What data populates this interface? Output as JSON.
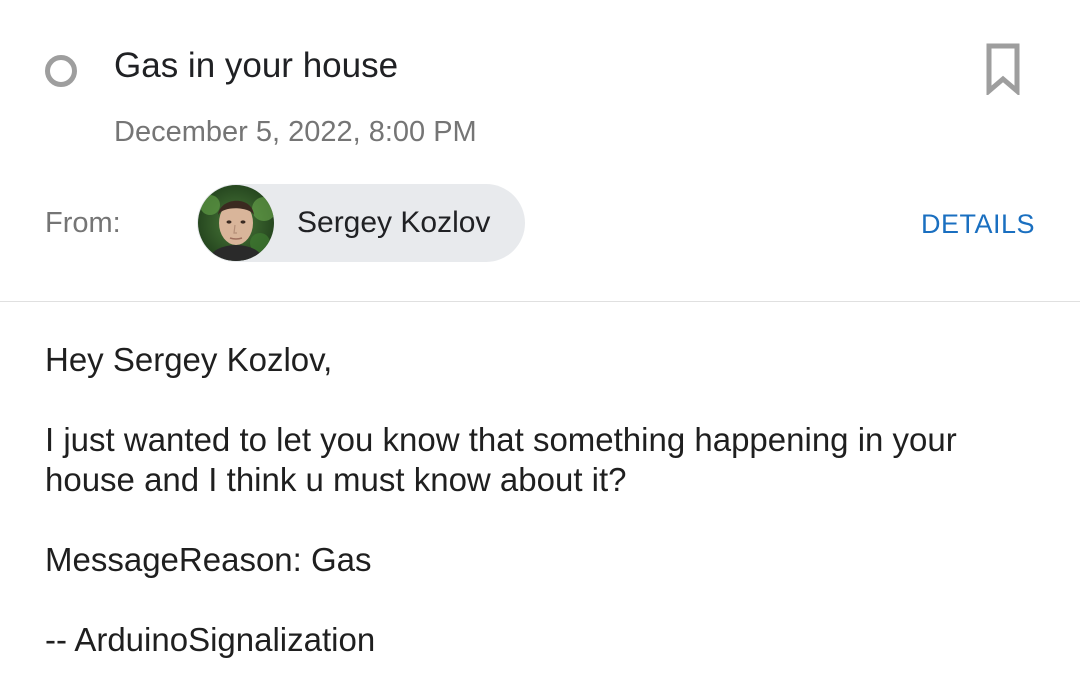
{
  "email": {
    "subject": "Gas in your house",
    "date": "December 5, 2022, 8:00 PM",
    "from_label": "From:",
    "sender_name": "Sergey Kozlov",
    "details_label": "DETAILS",
    "body": [
      "Hey Sergey Kozlov,",
      "I just wanted to let you know that something happening in your house and I think u must know about it?",
      "MessageReason: Gas",
      "-- ArduinoSignalization"
    ]
  },
  "icons": {
    "status": "unread-circle-icon",
    "bookmark": "bookmark-icon",
    "avatar": "sender-avatar"
  },
  "colors": {
    "accent": "#1a6fc0",
    "chip_bg": "#e8eaed",
    "muted_text": "#757575",
    "icon_gray": "#9e9e9e"
  }
}
